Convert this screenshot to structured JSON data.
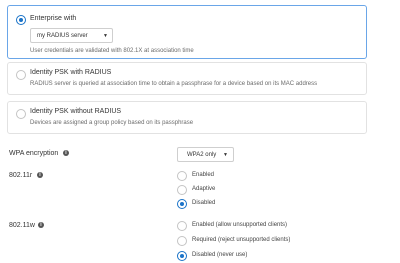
{
  "auth_options": [
    {
      "title": "Enterprise with",
      "selected": true,
      "server_select": "my RADIUS server",
      "description": "User credentials are validated with 802.1X at association time"
    },
    {
      "title": "Identity PSK with RADIUS",
      "selected": false,
      "description": "RADIUS server is queried at association time to obtain a passphrase for a device based on its MAC address"
    },
    {
      "title": "Identity PSK without RADIUS",
      "selected": false,
      "description": "Devices are assigned a group policy based on its passphrase"
    }
  ],
  "wpa": {
    "label": "WPA encryption",
    "value": "WPA2 only"
  },
  "r80211": {
    "label": "802.11r",
    "options": [
      {
        "label": "Enabled",
        "selected": false
      },
      {
        "label": "Adaptive",
        "selected": false
      },
      {
        "label": "Disabled",
        "selected": true
      }
    ]
  },
  "w80211": {
    "label": "802.11w",
    "options": [
      {
        "label": "Enabled (allow unsupported clients)",
        "selected": false
      },
      {
        "label": "Required (reject unsupported clients)",
        "selected": false
      },
      {
        "label": "Disabled (never use)",
        "selected": true
      }
    ]
  },
  "colors": {
    "accent": "#1a73c8",
    "selected_border": "#6aa6e8",
    "card_border": "#e2e2e2"
  },
  "icons": {
    "info": "info-icon",
    "dropdown": "caret-down-icon"
  }
}
